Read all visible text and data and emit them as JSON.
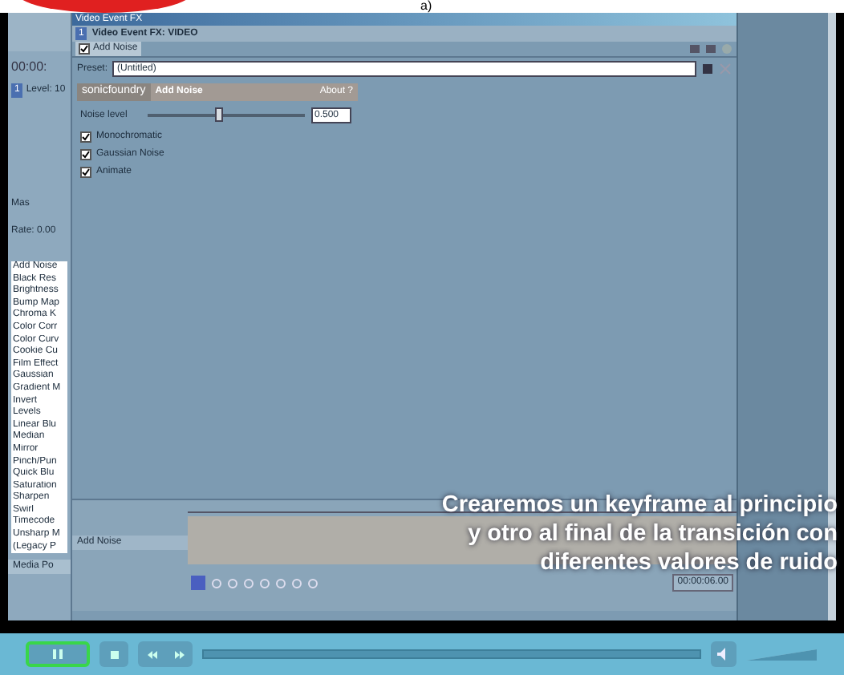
{
  "header": {
    "label": "a)"
  },
  "app": {
    "time": "00:00:",
    "track_number": "1",
    "level": "Level: 10",
    "track_label": "Mas",
    "rate": "Rate: 0.00",
    "media_tab": "Media Po",
    "effects": [
      "Add Noise",
      "Black Res",
      "Brightness",
      "Bump Map",
      "Chroma K",
      "Color Corr",
      "Color Curv",
      "Cookie Cu",
      "Film Effect",
      "Gaussian",
      "Gradient M",
      "Invert",
      "Levels",
      "Linear Blu",
      "Median",
      "Mirror",
      "Pinch/Pun",
      "Quick Blu",
      "Saturation",
      "Sharpen",
      "Swirl",
      "Timecode",
      "Unsharp M",
      "(Legacy P"
    ]
  },
  "fx_window": {
    "title": "Video Event FX",
    "heading": "Video Event FX: VIDEO",
    "chain_number": "1",
    "chain": [
      {
        "label": "Add Noise",
        "checked": true
      }
    ],
    "preset_label": "Preset:",
    "preset_value": "(Untitled)",
    "plugin": {
      "brand": "sonicfoundry",
      "name": "Add Noise",
      "about": "About ?"
    },
    "slider": {
      "label": "Noise level",
      "level": 0.45,
      "value": "0.500"
    },
    "options": [
      {
        "label": "Monochromatic",
        "checked": true
      },
      {
        "label": "Gaussian Noise",
        "checked": true
      },
      {
        "label": "Animate",
        "checked": true
      }
    ]
  },
  "timeline": {
    "track": "Add Noise",
    "time": "00:00:06.00"
  },
  "caption": [
    "Crearemos un keyframe al principio",
    "y otro al final de la transición con",
    "diferentes valores de ruido"
  ],
  "player": {
    "playing": true,
    "volume": {
      "level": 1
    }
  }
}
